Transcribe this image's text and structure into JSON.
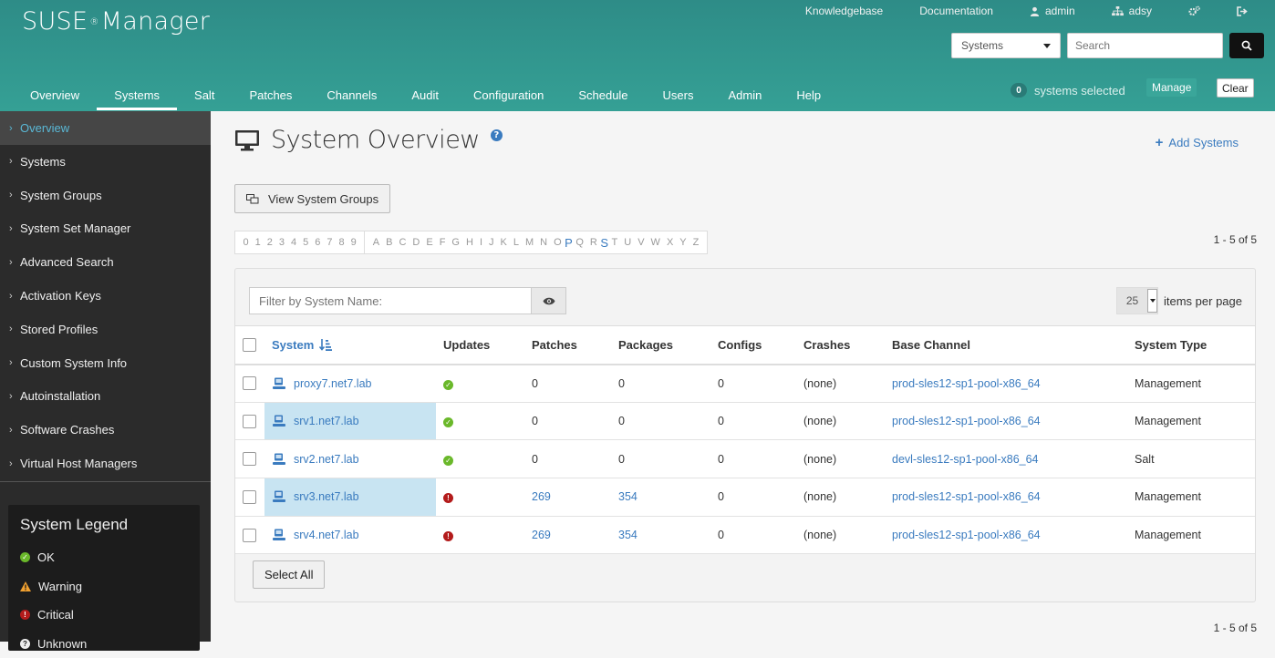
{
  "app": {
    "logo": "SUSE",
    "logo_suffix": "Manager",
    "reg_mark": "®"
  },
  "toplinks": {
    "knowledgebase": "Knowledgebase",
    "documentation": "Documentation",
    "user": "admin",
    "org": "adsy"
  },
  "search": {
    "type_selected": "Systems",
    "placeholder": "Search"
  },
  "nav": [
    {
      "label": "Overview"
    },
    {
      "label": "Systems"
    },
    {
      "label": "Salt"
    },
    {
      "label": "Patches"
    },
    {
      "label": "Channels"
    },
    {
      "label": "Audit"
    },
    {
      "label": "Configuration"
    },
    {
      "label": "Schedule"
    },
    {
      "label": "Users"
    },
    {
      "label": "Admin"
    },
    {
      "label": "Help"
    }
  ],
  "ssm": {
    "count": "0",
    "label": "systems selected",
    "manage": "Manage",
    "clear": "Clear"
  },
  "sidebar": {
    "items": [
      {
        "label": "Overview"
      },
      {
        "label": "Systems"
      },
      {
        "label": "System Groups"
      },
      {
        "label": "System Set Manager"
      },
      {
        "label": "Advanced Search"
      },
      {
        "label": "Activation Keys"
      },
      {
        "label": "Stored Profiles"
      },
      {
        "label": "Custom System Info"
      },
      {
        "label": "Autoinstallation"
      },
      {
        "label": "Software Crashes"
      },
      {
        "label": "Virtual Host Managers"
      }
    ],
    "legend": {
      "title": "System Legend",
      "items": [
        {
          "label": "OK"
        },
        {
          "label": "Warning"
        },
        {
          "label": "Critical"
        },
        {
          "label": "Unknown"
        }
      ]
    }
  },
  "page": {
    "title": "System Overview",
    "add_systems": "Add Systems",
    "view_groups": "View System Groups",
    "count_text": "1 - 5 of 5",
    "alpha_digits": [
      "0",
      "1",
      "2",
      "3",
      "4",
      "5",
      "6",
      "7",
      "8",
      "9"
    ],
    "alpha_letters": [
      "A",
      "B",
      "C",
      "D",
      "E",
      "F",
      "G",
      "H",
      "I",
      "J",
      "K",
      "L",
      "M",
      "N",
      "O",
      "P",
      "Q",
      "R",
      "S",
      "T",
      "U",
      "V",
      "W",
      "X",
      "Y",
      "Z"
    ],
    "filter_placeholder": "Filter by System Name:",
    "per_page_value": "25",
    "per_page_label": "items per page",
    "select_all": "Select All"
  },
  "table": {
    "headers": {
      "system": "System",
      "updates": "Updates",
      "patches": "Patches",
      "packages": "Packages",
      "configs": "Configs",
      "crashes": "Crashes",
      "base_channel": "Base Channel",
      "system_type": "System Type"
    },
    "rows": [
      {
        "name": "proxy7.net7.lab",
        "status": "ok",
        "patches": "0",
        "packages": "0",
        "configs": "0",
        "crashes": "(none)",
        "channel": "prod-sles12-sp1-pool-x86_64",
        "type": "Management"
      },
      {
        "name": "srv1.net7.lab",
        "status": "ok",
        "patches": "0",
        "packages": "0",
        "configs": "0",
        "crashes": "(none)",
        "channel": "prod-sles12-sp1-pool-x86_64",
        "type": "Management"
      },
      {
        "name": "srv2.net7.lab",
        "status": "ok",
        "patches": "0",
        "packages": "0",
        "configs": "0",
        "crashes": "(none)",
        "channel": "devl-sles12-sp1-pool-x86_64",
        "type": "Salt"
      },
      {
        "name": "srv3.net7.lab",
        "status": "critical",
        "patches": "269",
        "packages": "354",
        "configs": "0",
        "crashes": "(none)",
        "channel": "prod-sles12-sp1-pool-x86_64",
        "type": "Management"
      },
      {
        "name": "srv4.net7.lab",
        "status": "critical",
        "patches": "269",
        "packages": "354",
        "configs": "0",
        "crashes": "(none)",
        "channel": "prod-sles12-sp1-pool-x86_64",
        "type": "Management"
      }
    ]
  },
  "colors": {
    "header": "#35a095",
    "link": "#3a7bbf",
    "ok": "#6ab82a",
    "critical": "#b31b1b",
    "warning": "#f0a030"
  }
}
